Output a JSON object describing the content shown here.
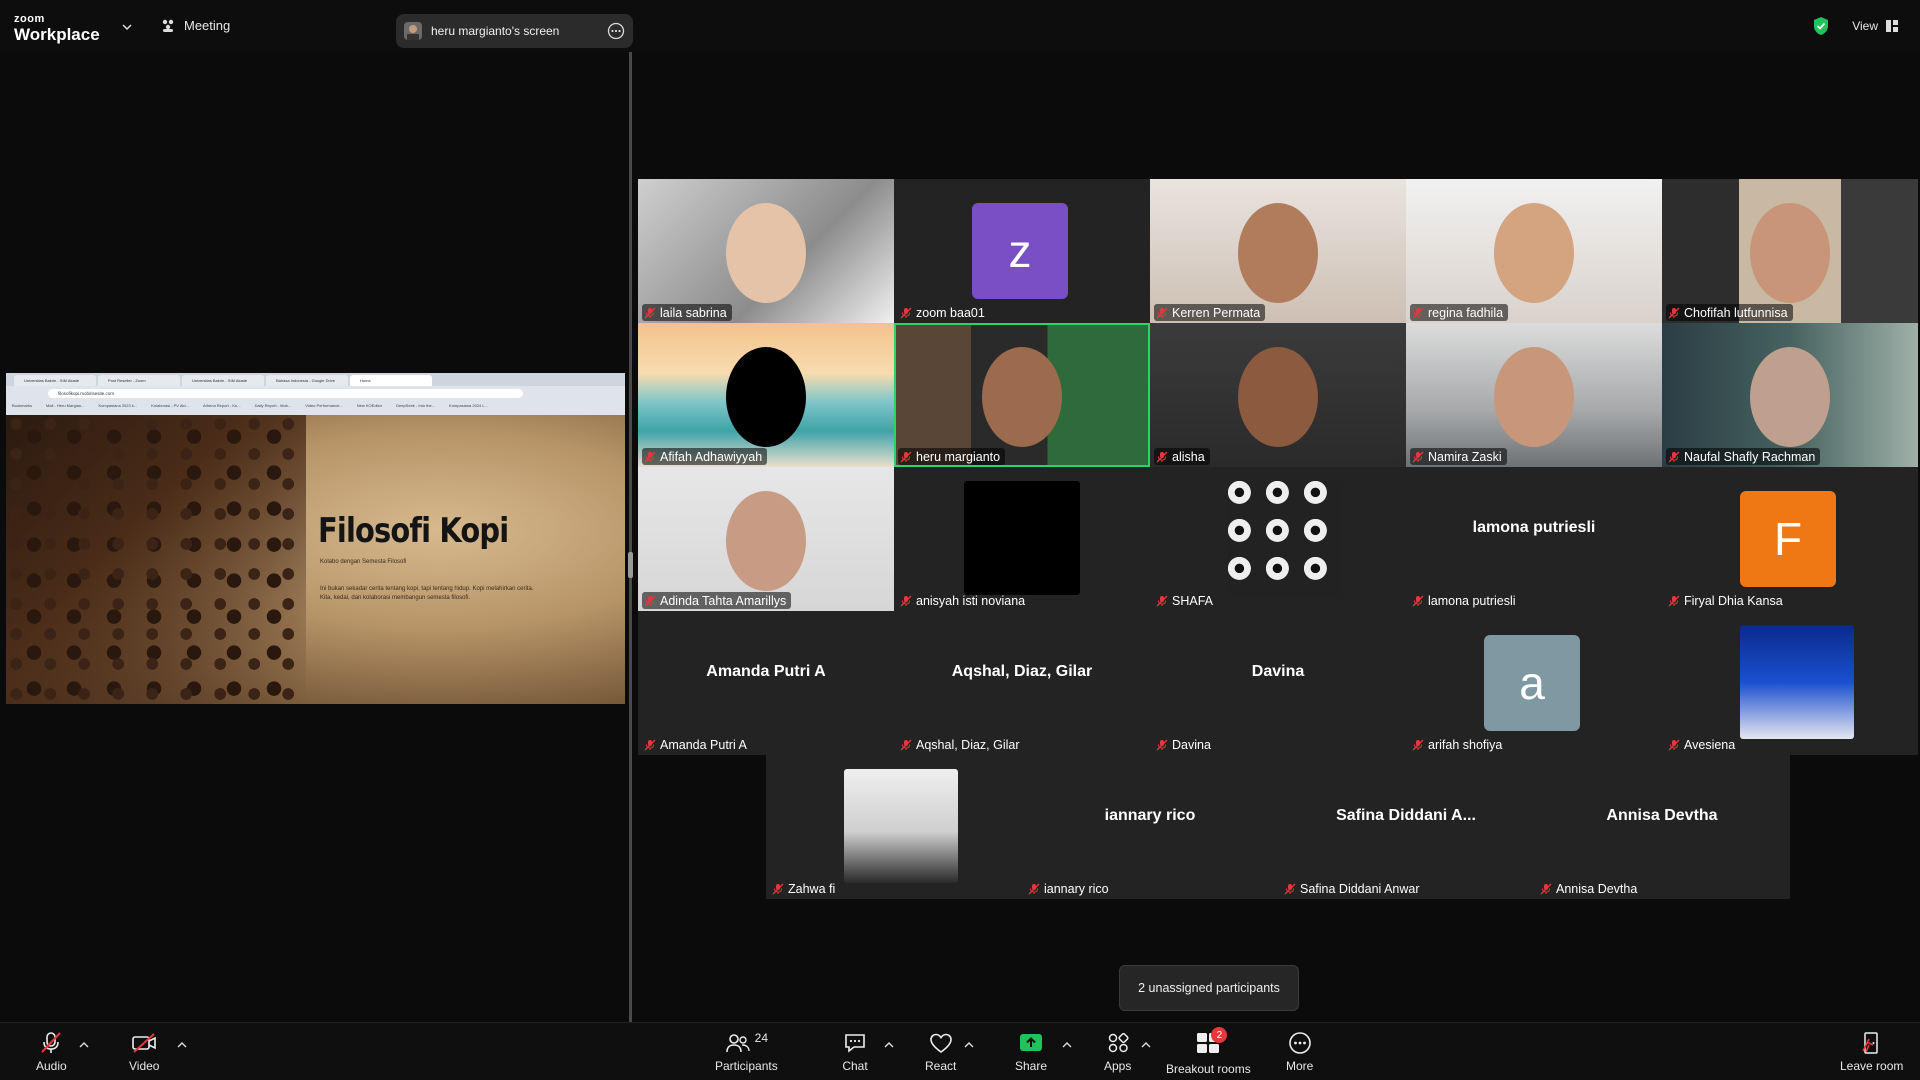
{
  "app": {
    "brand_top": "zoom",
    "brand_bottom": "Workplace"
  },
  "header": {
    "meeting_label": "Meeting",
    "screen_share_label": "heru margianto's screen",
    "view_label": "View"
  },
  "shared_screen": {
    "tabs": [
      "Universitas Bakrie - SIM Akade",
      "Post Reseller - Zoom",
      "Universitas Bakrie - SIM Akade",
      "Bahasa Indonesia - Google Drive",
      "Home"
    ],
    "address": "filosofikopi.mobirisesite.com",
    "bookmarks": [
      "Bookmarks",
      "Mail - Heru Margian...",
      "Kompasiana 2023 k...",
      "Kolaborasi - PV Aid...",
      "Athena Report - Ku...",
      "Daily Report - Mob...",
      "Video Performance...",
      "New KOEditor",
      "DeepSeek - Into the...",
      "Kompasiana 2024 L..."
    ],
    "slide_title": "Filosofi Kopi",
    "slide_subtitle": "Kolabo dengan Semesta Filosofi",
    "slide_body": "Ini bukan sekadar cerita tentang kopi, tapi tentang hidup. Kopi melahirkan cerita. Kita, kedai, dan kolaborasi membangun semesta filosofi."
  },
  "participants": [
    {
      "name": "laila sabrina",
      "kind": "video"
    },
    {
      "name": "zoom baa01",
      "kind": "letter",
      "letter": "z",
      "color": "#7a4fc6"
    },
    {
      "name": "Kerren Permata",
      "kind": "video"
    },
    {
      "name": "regina fadhila",
      "kind": "video"
    },
    {
      "name": "Chofifah lutfunnisa",
      "kind": "video"
    },
    {
      "name": "Afifah Adhawiyyah",
      "kind": "video"
    },
    {
      "name": "heru margianto",
      "kind": "video",
      "speaking": true
    },
    {
      "name": "alisha",
      "kind": "video"
    },
    {
      "name": "Namira Zaski",
      "kind": "video"
    },
    {
      "name": "Naufal Shafly Rachman",
      "kind": "video"
    },
    {
      "name": "Adinda Tahta Amarillys",
      "kind": "video"
    },
    {
      "name": "anisyah isti noviana",
      "kind": "image"
    },
    {
      "name": "SHAFA",
      "kind": "image"
    },
    {
      "name": "lamona putriesli",
      "kind": "name",
      "display": "lamona putriesli"
    },
    {
      "name": "Firyal Dhia Kansa",
      "kind": "letter",
      "letter": "F",
      "color": "#ef7714"
    },
    {
      "name": "Amanda Putri A",
      "kind": "name",
      "display": "Amanda Putri A"
    },
    {
      "name": "Aqshal, Diaz, Gilar",
      "kind": "name",
      "display": "Aqshal, Diaz, Gilar"
    },
    {
      "name": "Davina",
      "kind": "name",
      "display": "Davina"
    },
    {
      "name": "arifah shofiya",
      "kind": "letter",
      "letter": "a",
      "color": "#7f99a3"
    },
    {
      "name": "Avesiena",
      "kind": "image"
    },
    {
      "name": "Zahwa fi",
      "kind": "image"
    },
    {
      "name": "iannary rico",
      "kind": "name",
      "display": "iannary rico"
    },
    {
      "name": "Safina Diddani Anwar",
      "kind": "name",
      "display": "Safina  Diddani  A..."
    },
    {
      "name": "Annisa Devtha",
      "kind": "name",
      "display": "Annisa Devtha"
    }
  ],
  "tooltip": "2 unassigned participants",
  "toolbar": {
    "audio": "Audio",
    "video": "Video",
    "participants": "Participants",
    "participants_count": "24",
    "chat": "Chat",
    "react": "React",
    "share": "Share",
    "apps": "Apps",
    "breakout": "Breakout rooms",
    "breakout_badge": "2",
    "more": "More",
    "leave": "Leave room"
  },
  "colors": {
    "speaking": "#2bd46a",
    "share_green": "#1ec35a",
    "badge_red": "#e5383b",
    "mic_off": "#e5383b"
  }
}
